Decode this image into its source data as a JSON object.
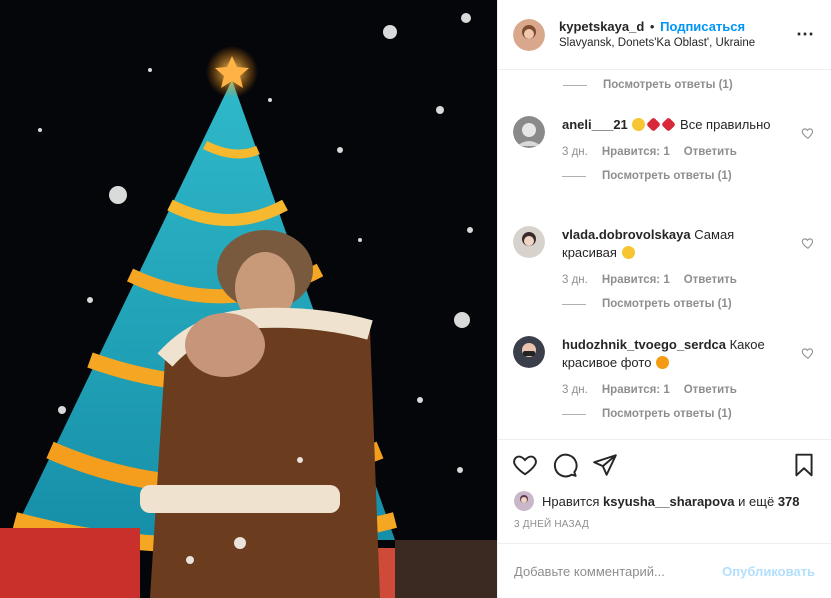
{
  "header": {
    "username": "kypetskaya_d",
    "separator": "•",
    "follow_label": "Подписаться",
    "location": "Slavyansk, Donets'Ka Oblast', Ukraine",
    "more_icon": "⋯"
  },
  "top_reply": {
    "label": "Посмотреть ответы (1)"
  },
  "comments": [
    {
      "username": "aneli___21",
      "text": "Все правильно",
      "emojis": [
        "wink-kiss-emoji",
        "heart-emoji",
        "heart-emoji"
      ],
      "age": "3 дн.",
      "likes": "Нравится: 1",
      "reply_label": "Ответить",
      "view_replies": "Посмотреть ответы (1)"
    },
    {
      "username": "vlada.dobrovolskaya",
      "text": "Самая красивая",
      "emojis": [
        "kiss-emoji"
      ],
      "age": "3 дн.",
      "likes": "Нравится: 1",
      "reply_label": "Ответить",
      "view_replies": "Посмотреть ответы (1)"
    },
    {
      "username": "hudozhnik_tvoego_serdca",
      "text": "Какое красивое фото",
      "emojis": [
        "cat-emoji"
      ],
      "age": "3 дн.",
      "likes": "Нравится: 1",
      "reply_label": "Ответить",
      "view_replies": "Посмотреть ответы (1)"
    }
  ],
  "likes": {
    "prefix": "Нравится",
    "user": "ksyusha__sharapova",
    "suffix": "и ещё",
    "count": "378"
  },
  "date": "3 ДНЕЙ НАЗАД",
  "add_comment": {
    "placeholder": "Добавьте комментарий...",
    "publish_label": "Опубликовать"
  },
  "colors": {
    "accent": "#0095f6",
    "publish_disabled": "#b2dffc",
    "secondary_text": "#8e8e8e",
    "heart_red": "#e0245e"
  }
}
